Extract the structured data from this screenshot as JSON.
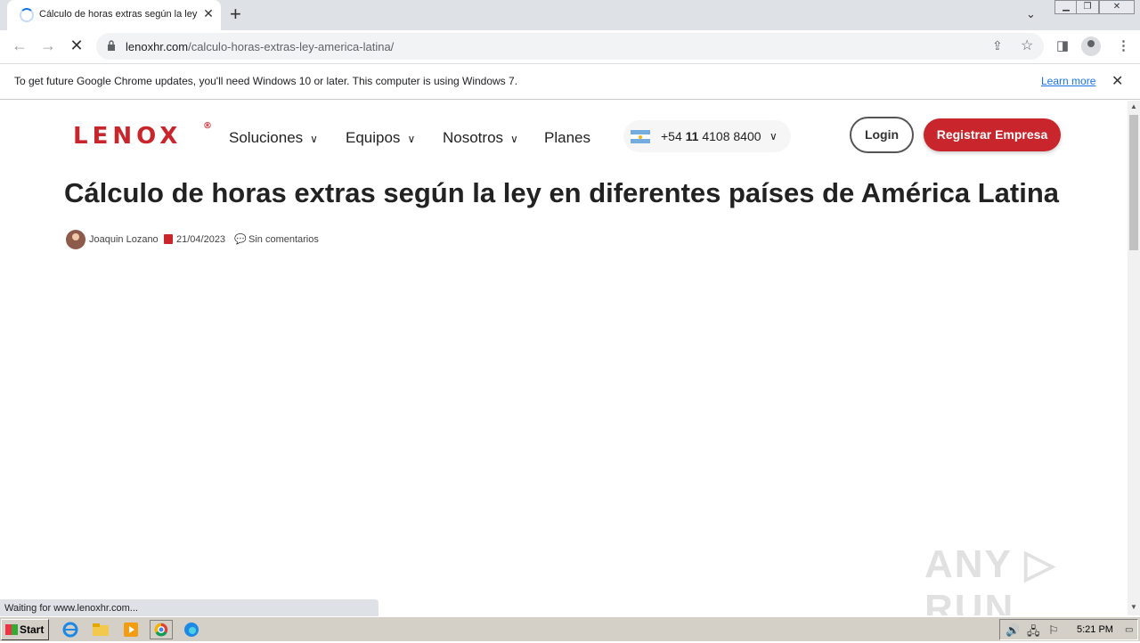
{
  "browser": {
    "tab_title": "Cálculo de horas extras según la ley",
    "tab_close": "✕",
    "new_tab": "+",
    "url_host": "lenoxhr.com",
    "url_path": "/calculo-horas-extras-ley-america-latina/",
    "infobar_message": "To get future Google Chrome updates, you'll need Windows 10 or later. This computer is using Windows 7.",
    "infobar_link": "Learn more",
    "status_text": "Waiting for www.lenoxhr.com..."
  },
  "site": {
    "logo_text": "LENOX",
    "logo_mark": "®",
    "nav": [
      {
        "label": "Soluciones"
      },
      {
        "label": "Equipos"
      },
      {
        "label": "Nosotros"
      },
      {
        "label": "Planes"
      }
    ],
    "phone_prefix": "+54 ",
    "phone_bold": "11",
    "phone_rest": " 4108 8400",
    "login_label": "Login",
    "register_label": "Registrar Empresa"
  },
  "article": {
    "title": "Cálculo de horas extras según la ley en diferentes países de América Latina",
    "author": "Joaquin  Lozano",
    "date": "21/04/2023",
    "comments": "Sin  comentarios"
  },
  "watermark": "ANY ▷ RUN",
  "taskbar": {
    "start_label": "Start",
    "clock": "5:21 PM"
  },
  "colors": {
    "brand_red": "#c8262c",
    "link_blue": "#1a73e8"
  }
}
